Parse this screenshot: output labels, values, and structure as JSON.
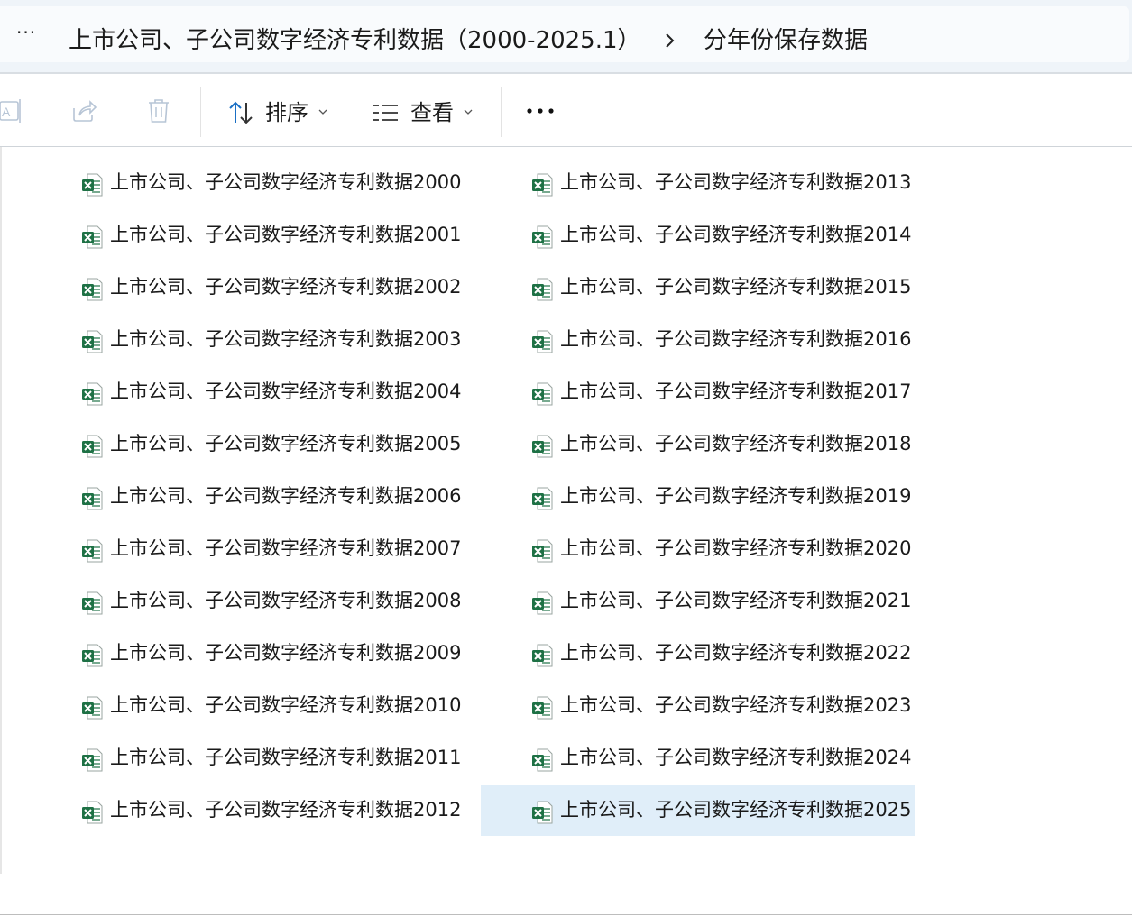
{
  "address_bar": {
    "more_label": "···",
    "crumbs": [
      "上市公司、子公司数字经济专利数据（2000-2025.1）",
      "分年份保存数据"
    ],
    "separator_icon": "chevron-right-icon"
  },
  "toolbar": {
    "icons": [
      "rename-icon",
      "share-icon",
      "delete-icon"
    ],
    "sort_label": "排序",
    "sort_icon": "sort-arrows-icon",
    "view_label": "查看",
    "view_icon": "view-list-icon",
    "more_icon": "more-horizontal-icon"
  },
  "files": {
    "icon": "excel-file-icon",
    "column_1": [
      "上市公司、子公司数字经济专利数据2000",
      "上市公司、子公司数字经济专利数据2001",
      "上市公司、子公司数字经济专利数据2002",
      "上市公司、子公司数字经济专利数据2003",
      "上市公司、子公司数字经济专利数据2004",
      "上市公司、子公司数字经济专利数据2005",
      "上市公司、子公司数字经济专利数据2006",
      "上市公司、子公司数字经济专利数据2007",
      "上市公司、子公司数字经济专利数据2008",
      "上市公司、子公司数字经济专利数据2009",
      "上市公司、子公司数字经济专利数据2010",
      "上市公司、子公司数字经济专利数据2011",
      "上市公司、子公司数字经济专利数据2012"
    ],
    "column_2": [
      "上市公司、子公司数字经济专利数据2013",
      "上市公司、子公司数字经济专利数据2014",
      "上市公司、子公司数字经济专利数据2015",
      "上市公司、子公司数字经济专利数据2016",
      "上市公司、子公司数字经济专利数据2017",
      "上市公司、子公司数字经济专利数据2018",
      "上市公司、子公司数字经济专利数据2019",
      "上市公司、子公司数字经济专利数据2020",
      "上市公司、子公司数字经济专利数据2021",
      "上市公司、子公司数字经济专利数据2022",
      "上市公司、子公司数字经济专利数据2023",
      "上市公司、子公司数字经济专利数据2024",
      "上市公司、子公司数字经济专利数据2025"
    ],
    "selected": "上市公司、子公司数字经济专利数据2025"
  },
  "colors": {
    "selection": "#e0eef9",
    "excel_green": "#1e7145",
    "accent_blue": "#1a6fc4"
  }
}
